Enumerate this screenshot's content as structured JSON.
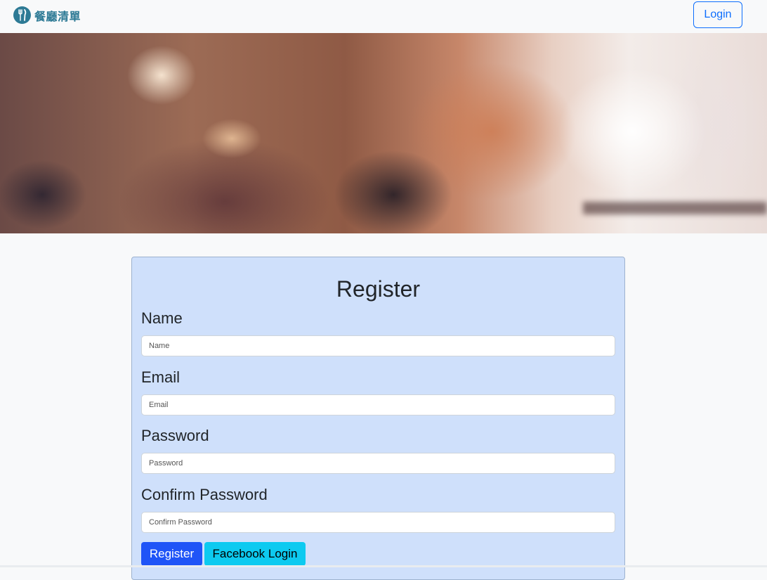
{
  "navbar": {
    "brand_name": "餐廳清單",
    "brand_icon": "fork-knife-icon",
    "login_label": "Login"
  },
  "hero": {
    "image": "blurred-restaurant-photo"
  },
  "form": {
    "title": "Register",
    "fields": [
      {
        "label": "Name",
        "placeholder": "Name",
        "value": ""
      },
      {
        "label": "Email",
        "placeholder": "Email",
        "value": ""
      },
      {
        "label": "Password",
        "placeholder": "Password",
        "value": ""
      },
      {
        "label": "Confirm Password",
        "placeholder": "Confirm Password",
        "value": ""
      }
    ],
    "register_label": "Register",
    "facebook_label": "Facebook Login"
  },
  "colors": {
    "brand": "#2d7a95",
    "primary": "#1f54f7",
    "info": "#0dcaf0",
    "card_bg": "#cfe0fb"
  }
}
